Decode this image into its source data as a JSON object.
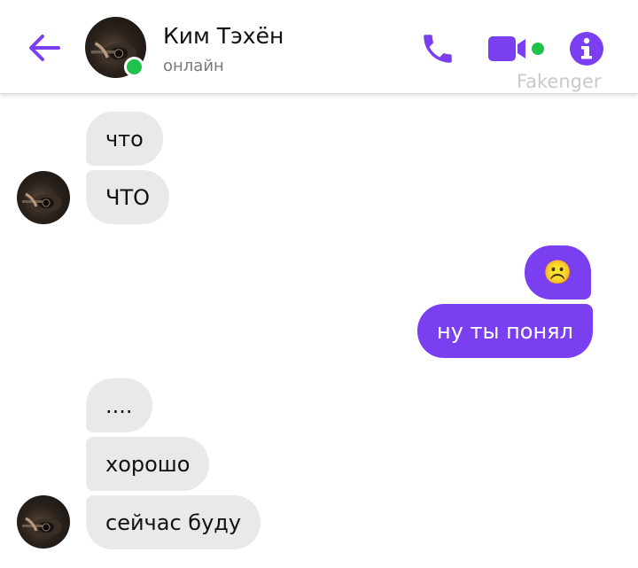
{
  "header": {
    "contact_name": "Ким Тэхён",
    "status": "онлайн",
    "watermark": "Fakenger",
    "accent_color": "#7b3ff2",
    "online_color": "#1fc24a",
    "icons": [
      "arrow-left-icon",
      "phone-icon",
      "video-camera-icon",
      "info-icon"
    ]
  },
  "messages": [
    {
      "side": "incoming",
      "text": "что"
    },
    {
      "side": "incoming",
      "text": "ЧТО"
    },
    {
      "side": "outgoing",
      "text": "☹️"
    },
    {
      "side": "outgoing",
      "text": "ну ты понял"
    },
    {
      "side": "incoming",
      "text": "...."
    },
    {
      "side": "incoming",
      "text": "хорошо"
    },
    {
      "side": "incoming",
      "text": "сейчас буду"
    }
  ]
}
